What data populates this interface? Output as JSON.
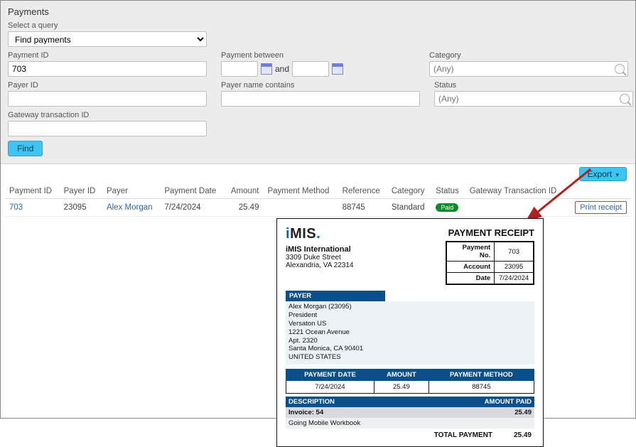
{
  "panel": {
    "title": "Payments",
    "query_label": "Select a query",
    "query_value": "Find payments",
    "payment_id_label": "Payment ID",
    "payment_id_value": "703",
    "payer_id_label": "Payer ID",
    "gateway_label": "Gateway transaction ID",
    "between_label": "Payment between",
    "between_and": "and",
    "payer_name_label": "Payer name contains",
    "category_label": "Category",
    "category_placeholder": "(Any)",
    "status_label": "Status",
    "status_placeholder": "(Any)",
    "find": "Find"
  },
  "results": {
    "export": "Export",
    "headers": {
      "payment_id": "Payment ID",
      "payer_id": "Payer ID",
      "payer": "Payer",
      "date": "Payment Date",
      "amount": "Amount",
      "method": "Payment Method",
      "reference": "Reference",
      "category": "Category",
      "status": "Status",
      "gateway": "Gateway Transaction ID"
    },
    "row": {
      "payment_id": "703",
      "payer_id": "23095",
      "payer": "Alex Morgan",
      "date": "7/24/2024",
      "amount": "25.49",
      "reference": "88745",
      "category": "Standard",
      "status": "Paid",
      "print": "Print receipt"
    }
  },
  "receipt": {
    "title": "PAYMENT RECEIPT",
    "org_name": "iMIS International",
    "org_addr1": "3309 Duke Street",
    "org_addr2": "Alexandria, VA 22314",
    "meta": {
      "no_label": "Payment No.",
      "no": "703",
      "acct_label": "Account",
      "acct": "23095",
      "date_label": "Date",
      "date": "7/24/2024"
    },
    "payer_hdr": "PAYER",
    "payer": {
      "line1": "Alex Morgan (23095)",
      "line2": "President",
      "line3": "Versaton US",
      "line4": "1221 Ocean Avenue",
      "line5": "Apt. 2320",
      "line6": "Santa Monica, CA 90401",
      "line7": "UNITED STATES"
    },
    "pay_headers": {
      "date": "PAYMENT DATE",
      "amount": "AMOUNT",
      "method": "PAYMENT METHOD"
    },
    "pay_row": {
      "date": "7/24/2024",
      "amount": "25.49",
      "method": "88745"
    },
    "desc_headers": {
      "desc": "DESCRIPTION",
      "paid": "AMOUNT PAID"
    },
    "desc_rows": {
      "r1_desc": "Invoice: 54",
      "r1_paid": "25.49",
      "r2_desc": "Going Mobile Workbook"
    },
    "total_label": "TOTAL PAYMENT",
    "total": "25.49"
  }
}
